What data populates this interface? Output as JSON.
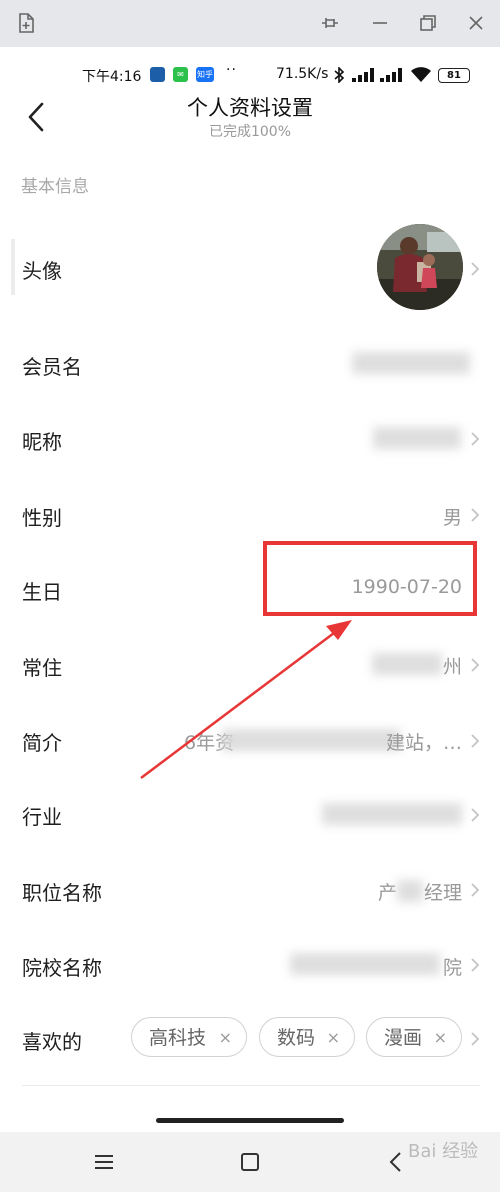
{
  "status_bar": {
    "time": "下午4:16",
    "app_badge_zhihu": "知乎",
    "dots": "··",
    "speed": "71.5K/s",
    "battery": "81"
  },
  "header": {
    "title": "个人资料设置",
    "subtitle": "已完成100%"
  },
  "section": {
    "title": "基本信息"
  },
  "rows": [
    {
      "label": "头像",
      "value": ""
    },
    {
      "label": "会员名",
      "value": ""
    },
    {
      "label": "昵称",
      "value": ""
    },
    {
      "label": "性别",
      "value": "男"
    },
    {
      "label": "生日",
      "value": "1990-07-20"
    },
    {
      "label": "常住",
      "value": "州"
    },
    {
      "label": "简介",
      "value": "6年资",
      "value_tail": "建站，…"
    },
    {
      "label": "行业",
      "value": ""
    },
    {
      "label": "职位名称",
      "value": "产",
      "value_tail": "经理"
    },
    {
      "label": "院校名称",
      "value": "院"
    }
  ],
  "likes": {
    "label": "喜欢的",
    "tags": [
      "高科技",
      "数码",
      "漫画"
    ],
    "remove_glyph": "×"
  },
  "watermark": "Bai 经验",
  "colors": {
    "highlight": "#e83535",
    "muted_text": "#9a9a9a",
    "tag_border": "#d2d2d2"
  }
}
